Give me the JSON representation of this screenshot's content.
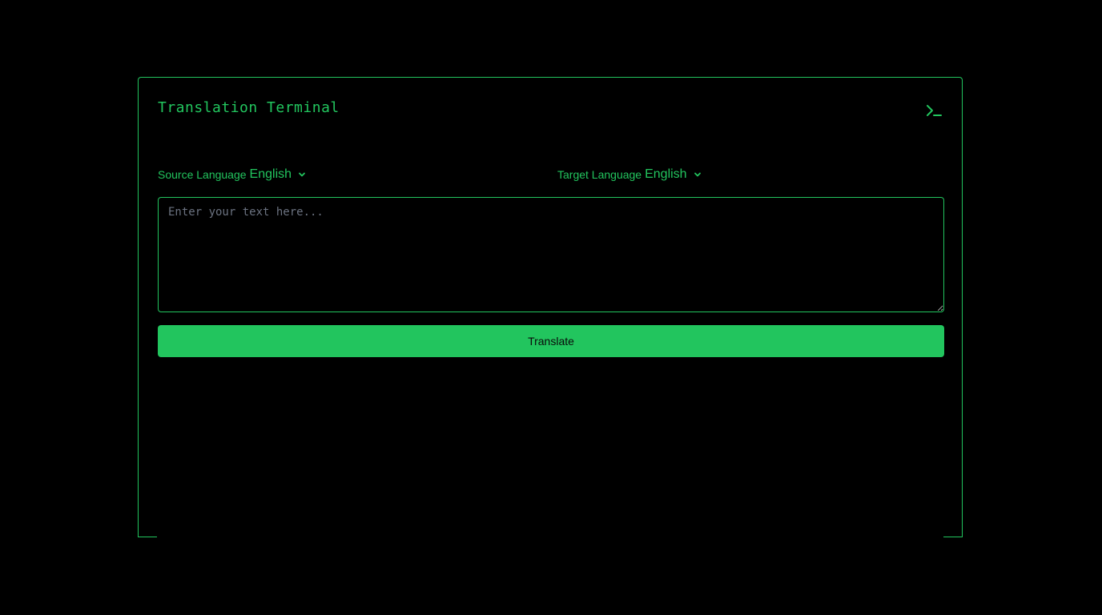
{
  "app": {
    "title": "Translation Terminal"
  },
  "icons": {
    "terminal": "terminal-prompt-icon",
    "chevron": "chevron-down-icon"
  },
  "source": {
    "label": "Source Language",
    "value": "English"
  },
  "target": {
    "label": "Target Language",
    "value": "English"
  },
  "input": {
    "value": "",
    "placeholder": "Enter your text here..."
  },
  "actions": {
    "translate_label": "Translate"
  },
  "colors": {
    "accent": "#22c55e",
    "background": "#000000",
    "placeholder": "#6b7280",
    "button_text": "#0a0a0a"
  }
}
